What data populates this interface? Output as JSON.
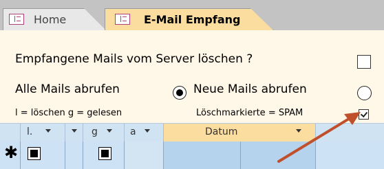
{
  "tabs": [
    {
      "label": "Home",
      "icon": "form-icon",
      "active": false
    },
    {
      "label": "E-Mail Empfang",
      "icon": "form-icon",
      "active": true
    }
  ],
  "form": {
    "delete_label": "Empfangene Mails vom Server löschen ?",
    "delete_checked": false,
    "all_mails_label": "Alle Mails abrufen",
    "all_mails_selected": true,
    "new_mails_label": "Neue Mails abrufen",
    "new_mails_selected": false,
    "legend_text": "l = löschen  g = gelesen",
    "spam_label": "Löschmarkierte = SPAM",
    "spam_checked": true
  },
  "grid": {
    "columns": [
      "l.",
      "",
      "g",
      "a",
      "Datum"
    ],
    "new_row_marker": "✱"
  },
  "colors": {
    "accent_tab": "#fbdda0",
    "grid_header": "#cfe3f2",
    "arrow": "#c0502c"
  }
}
